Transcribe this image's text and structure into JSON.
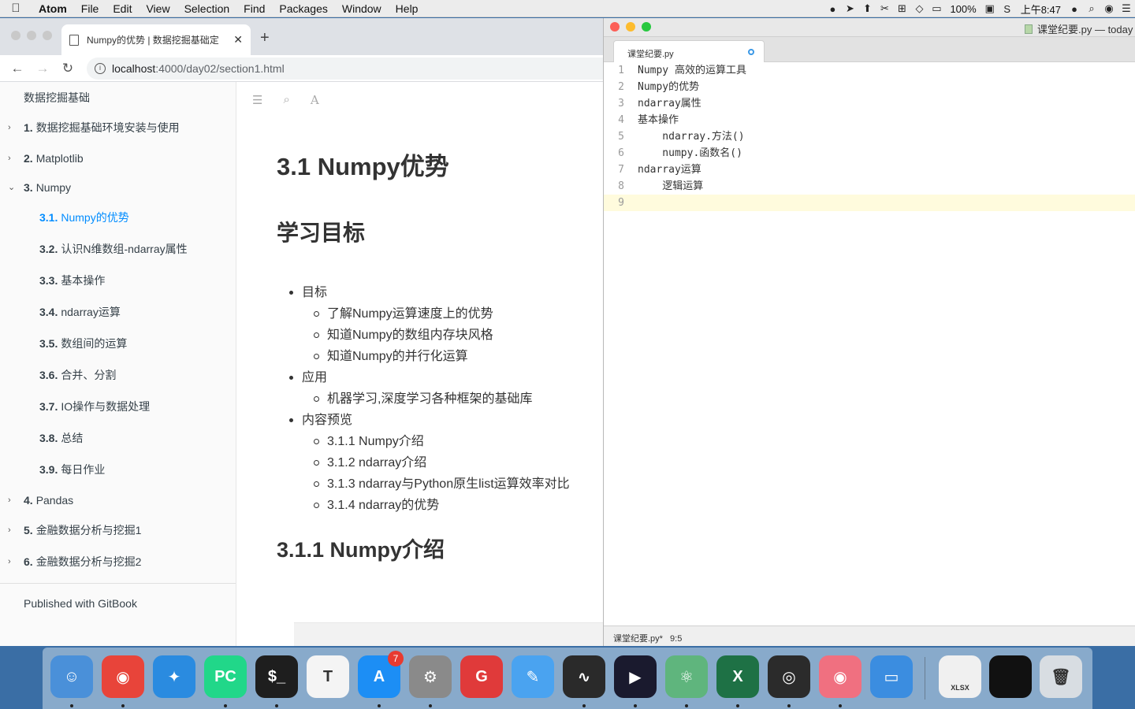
{
  "menubar": {
    "apple": "",
    "items": [
      "Atom",
      "File",
      "Edit",
      "View",
      "Selection",
      "Find",
      "Packages",
      "Window",
      "Help"
    ],
    "battery": "100%",
    "clock": "上午8:47"
  },
  "browser": {
    "tab_title": "Numpy的优势 | 数据挖掘基础定",
    "url_host": "localhost",
    "url_path": ":4000/day02/section1.html",
    "sidebar": {
      "book_title": "数据挖掘基础",
      "items": [
        {
          "num": "1.",
          "label": "数据挖掘基础环境安装与使用"
        },
        {
          "num": "2.",
          "label": "Matplotlib"
        },
        {
          "num": "3.",
          "label": "Numpy"
        },
        {
          "num": "3.1.",
          "label": "Numpy的优势"
        },
        {
          "num": "3.2.",
          "label": "认识N维数组-ndarray属性"
        },
        {
          "num": "3.3.",
          "label": "基本操作"
        },
        {
          "num": "3.4.",
          "label": "ndarray运算"
        },
        {
          "num": "3.5.",
          "label": "数组间的运算"
        },
        {
          "num": "3.6.",
          "label": "合并、分割"
        },
        {
          "num": "3.7.",
          "label": "IO操作与数据处理"
        },
        {
          "num": "3.8.",
          "label": "总结"
        },
        {
          "num": "3.9.",
          "label": "每日作业"
        },
        {
          "num": "4.",
          "label": "Pandas"
        },
        {
          "num": "5.",
          "label": "金融数据分析与挖掘1"
        },
        {
          "num": "6.",
          "label": "金融数据分析与挖掘2"
        }
      ],
      "published": "Published with GitBook"
    },
    "content": {
      "h1": "3.1 Numpy优势",
      "h2": "学习目标",
      "list": [
        "目标",
        "了解Numpy运算速度上的优势",
        "知道Numpy的数组内存块风格",
        "知道Numpy的并行化运算",
        "应用",
        "机器学习,深度学习各种框架的基础库",
        "内容预览",
        "3.1.1 Numpy介绍",
        "3.1.2 ndarray介绍",
        "3.1.3 ndarray与Python原生list运算效率对比",
        "3.1.4 ndarray的优势"
      ],
      "h3": "3.1.1 Numpy介绍"
    }
  },
  "atom": {
    "window_title": "课堂纪要.py — today",
    "tab_label": "课堂纪要.py",
    "lines": [
      {
        "n": "1",
        "t": "Numpy 高效的运算工具"
      },
      {
        "n": "2",
        "t": "Numpy的优势"
      },
      {
        "n": "3",
        "t": "ndarray属性"
      },
      {
        "n": "4",
        "t": "基本操作"
      },
      {
        "n": "5",
        "t": "    ndarray.方法()"
      },
      {
        "n": "6",
        "t": "    numpy.函数名()"
      },
      {
        "n": "7",
        "t": "ndarray运算"
      },
      {
        "n": "8",
        "t": "    逻辑运算"
      },
      {
        "n": "9",
        "t": ""
      }
    ],
    "status_file": "课堂纪要.py*",
    "status_cursor": "9:5"
  },
  "dock": {
    "apps": [
      {
        "name": "Finder",
        "color": "#4a90d9",
        "glyph": "☺"
      },
      {
        "name": "Chrome",
        "color": "#e8443a",
        "glyph": "◉"
      },
      {
        "name": "Safari",
        "color": "#2a8be0",
        "glyph": "✦"
      },
      {
        "name": "PyCharm",
        "color": "#21d789",
        "glyph": "PC"
      },
      {
        "name": "Terminal",
        "color": "#1e1e1e",
        "glyph": "$_"
      },
      {
        "name": "Typora",
        "color": "#f4f4f4",
        "glyph": "T"
      },
      {
        "name": "App Store",
        "color": "#1c8ef5",
        "glyph": "A",
        "badge": "7"
      },
      {
        "name": "System Preferences",
        "color": "#8a8a8a",
        "glyph": "⚙"
      },
      {
        "name": "Git client",
        "color": "#e03a3a",
        "glyph": "G"
      },
      {
        "name": "Notes",
        "color": "#4aa3f0",
        "glyph": "✎"
      },
      {
        "name": "Activity Monitor",
        "color": "#2a2a2a",
        "glyph": "∿"
      },
      {
        "name": "Media Player",
        "color": "#1a1a2e",
        "glyph": "▶"
      },
      {
        "name": "Atom",
        "color": "#5fb57d",
        "glyph": "⚛"
      },
      {
        "name": "Excel",
        "color": "#1e7145",
        "glyph": "X"
      },
      {
        "name": "OBS",
        "color": "#2b2b2b",
        "glyph": "◎"
      },
      {
        "name": "Viewer",
        "color": "#f07080",
        "glyph": "◉"
      },
      {
        "name": "Keynote",
        "color": "#3b8de0",
        "glyph": "▭"
      }
    ],
    "docs": [
      {
        "name": "XLSX document",
        "color": "#f0f0f0",
        "glyph": "XLSX"
      },
      {
        "name": "Terminal window",
        "color": "#111111",
        "glyph": ""
      },
      {
        "name": "Trash",
        "color": "#d8dde2",
        "glyph": "🗑"
      }
    ]
  }
}
